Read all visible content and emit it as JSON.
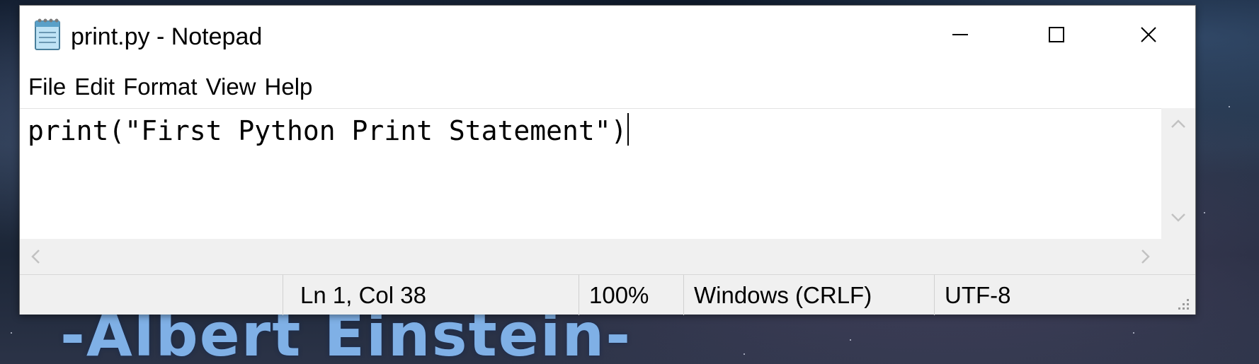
{
  "window": {
    "title": "print.py - Notepad",
    "icon": "notepad-icon",
    "controls": {
      "minimize_icon": "minimize-icon",
      "maximize_icon": "maximize-icon",
      "close_icon": "close-icon"
    }
  },
  "menu": {
    "items": [
      {
        "label": "File"
      },
      {
        "label": "Edit"
      },
      {
        "label": "Format"
      },
      {
        "label": "View"
      },
      {
        "label": "Help"
      }
    ]
  },
  "editor": {
    "content": "print(\"First Python Print Statement\")"
  },
  "status": {
    "position": "Ln 1, Col 38",
    "zoom": "100%",
    "line_endings": "Windows (CRLF)",
    "encoding": "UTF-8"
  },
  "wallpaper": {
    "visible_text": "-Albert Einstein-"
  },
  "colors": {
    "window_bg": "#ffffff",
    "chrome_bg": "#f0f0f0",
    "wallpaper_text": "#7fb0e6"
  }
}
